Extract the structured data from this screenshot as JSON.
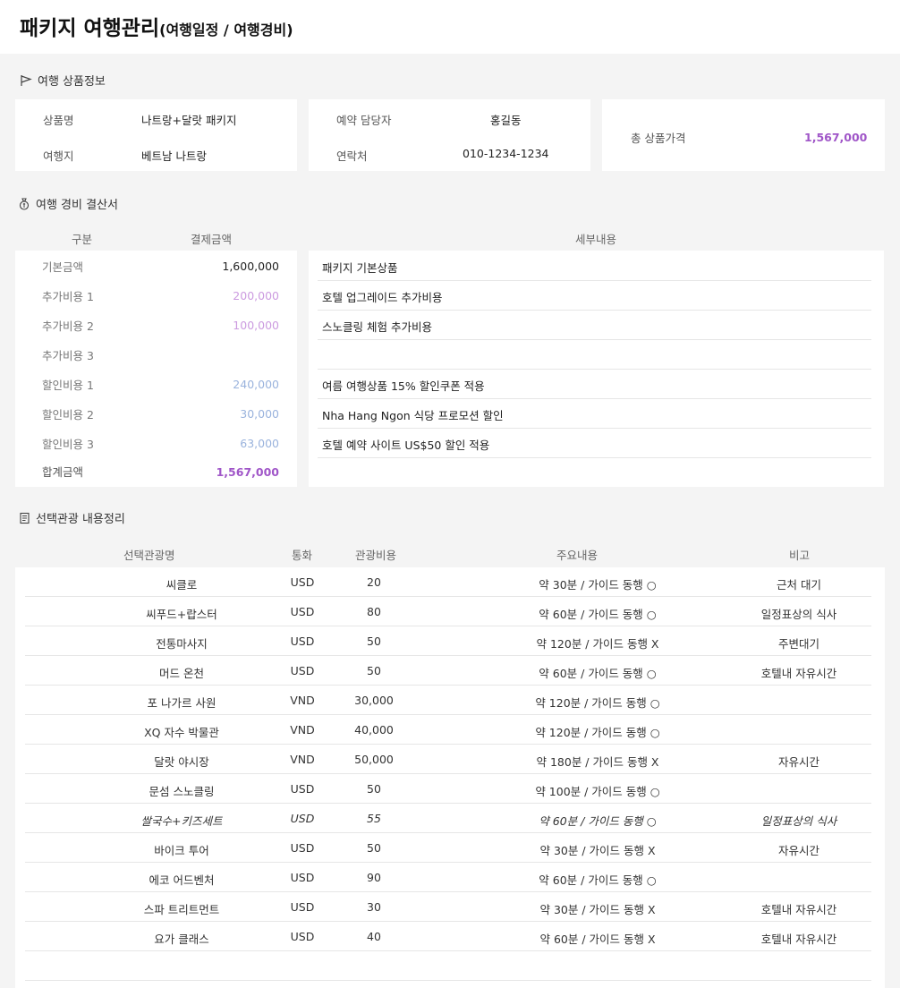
{
  "header": {
    "title": "패키지 여행관리",
    "subtitle": "(여행일정 / 여행경비)"
  },
  "product_info": {
    "section_title": "여행 상품정보",
    "product_name_label": "상품명",
    "product_name": "나트랑+달랏 패키지",
    "destination_label": "여행지",
    "destination": "베트남 나트랑",
    "manager_label": "예약 담당자",
    "manager": "홍길동",
    "contact_label": "연락처",
    "contact": "010-1234-1234",
    "total_label": "총 상품가격",
    "total": "1,567,000"
  },
  "expense": {
    "section_title": "여행 경비 결산서",
    "headers": {
      "category": "구분",
      "amount": "결제금액",
      "detail": "세부내용"
    },
    "rows": [
      {
        "category": "기본금액",
        "amount": "1,600,000",
        "detail": "패키지 기본상품"
      },
      {
        "category": "추가비용 1",
        "amount": "200,000",
        "detail": "호텔 업그레이드 추가비용"
      },
      {
        "category": "추가비용 2",
        "amount": "100,000",
        "detail": "스노클링 체험 추가비용"
      },
      {
        "category": "추가비용 3",
        "amount": "",
        "detail": ""
      },
      {
        "category": "할인비용 1",
        "amount": "240,000",
        "detail": "여름 여행상품 15% 할인쿠폰 적용"
      },
      {
        "category": "할인비용 2",
        "amount": "30,000",
        "detail": "Nha Hang Ngon 식당 프로모션 할인"
      },
      {
        "category": "할인비용 3",
        "amount": "63,000",
        "detail": "호텔 예약 사이트 US$50 할인 적용"
      }
    ],
    "total_label": "합계금액",
    "total": "1,567,000",
    "colors": {
      "base": "#222222",
      "additional": "#cc9be0",
      "discount": "#9ab3dd",
      "total": "#a056c8"
    }
  },
  "tours": {
    "section_title": "선택관광 내용정리",
    "headers": {
      "name": "선택관광명",
      "currency": "통화",
      "cost": "관광비용",
      "content": "주요내용",
      "note": "비고"
    },
    "rows": [
      {
        "name": "씨클로",
        "currency": "USD",
        "cost": "20",
        "content": "약 30분 / 가이드 동행 ○",
        "note": "근처 대기"
      },
      {
        "name": "씨푸드+랍스터",
        "currency": "USD",
        "cost": "80",
        "content": "약 60분 / 가이드 동행 ○",
        "note": "일정표상의 식사"
      },
      {
        "name": "전통마사지",
        "currency": "USD",
        "cost": "50",
        "content": "약 120분 / 가이드 동행 X",
        "note": "주변대기"
      },
      {
        "name": "머드 온천",
        "currency": "USD",
        "cost": "50",
        "content": "약 60분 / 가이드 동행 ○",
        "note": "호텔내 자유시간"
      },
      {
        "name": "포 나가르 사원",
        "currency": "VND",
        "cost": "30,000",
        "content": "약 120분 / 가이드 동행 ○",
        "note": ""
      },
      {
        "name": "XQ 자수 박물관",
        "currency": "VND",
        "cost": "40,000",
        "content": "약 120분 / 가이드 동행 ○",
        "note": ""
      },
      {
        "name": "달랏 야시장",
        "currency": "VND",
        "cost": "50,000",
        "content": "약 180분 / 가이드 동행 X",
        "note": "자유시간"
      },
      {
        "name": "문섬 스노클링",
        "currency": "USD",
        "cost": "50",
        "content": "약 100분 / 가이드 동행 ○",
        "note": ""
      },
      {
        "name": "쌀국수+키즈세트",
        "currency": "USD",
        "cost": "55",
        "content": "약 60분 / 가이드 동행 ○",
        "note": "일정표상의 식사"
      },
      {
        "name": "바이크 투어",
        "currency": "USD",
        "cost": "50",
        "content": "약 30분 / 가이드 동행 X",
        "note": "자유시간"
      },
      {
        "name": "에코 어드벤처",
        "currency": "USD",
        "cost": "90",
        "content": "약 60분 / 가이드 동행 ○",
        "note": ""
      },
      {
        "name": "스파 트리트먼트",
        "currency": "USD",
        "cost": "30",
        "content": "약 30분 / 가이드 동행 X",
        "note": "호텔내 자유시간"
      },
      {
        "name": "요가 클래스",
        "currency": "USD",
        "cost": "40",
        "content": "약 60분 / 가이드 동행 X",
        "note": "호텔내 자유시간"
      },
      {
        "name": "",
        "currency": "",
        "cost": "",
        "content": "",
        "note": ""
      }
    ]
  },
  "icons": {
    "product_info": "flag-icon",
    "expense": "money-bag-icon",
    "tours": "scroll-icon"
  }
}
